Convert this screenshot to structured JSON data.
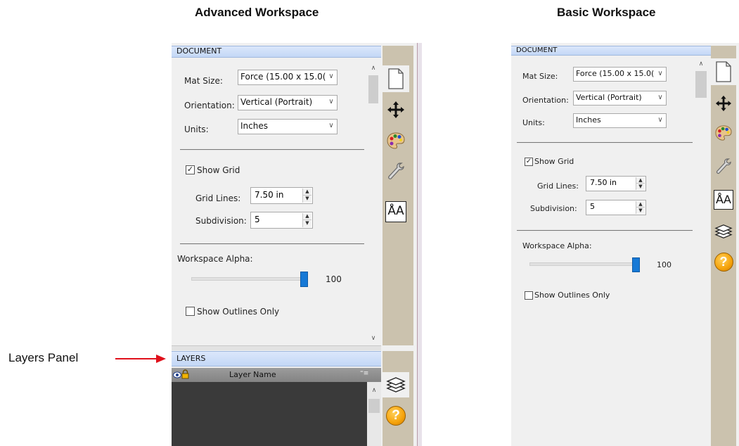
{
  "headings": {
    "advanced": "Advanced Workspace",
    "basic": "Basic Workspace"
  },
  "callout": {
    "label": "Layers Panel",
    "arrow_color": "#e0101b"
  },
  "document_panel": {
    "title": "DOCUMENT",
    "mat_size": {
      "label": "Mat Size:",
      "value": "Force (15.00 x 15.0("
    },
    "orientation": {
      "label": "Orientation:",
      "value": "Vertical (Portrait)"
    },
    "units": {
      "label": "Units:",
      "value": "Inches"
    },
    "show_grid": {
      "label": "Show Grid",
      "checked": true,
      "mark": "✓"
    },
    "grid_lines": {
      "label": "Grid Lines:",
      "value": "7.50 in"
    },
    "subdivision": {
      "label": "Subdivision:",
      "value": "5"
    },
    "workspace_alpha": {
      "label": "Workspace Alpha:",
      "value": "100",
      "level_percent": 100
    },
    "show_outlines_only": {
      "label": "Show Outlines Only",
      "checked": false
    }
  },
  "layers_panel": {
    "title": "LAYERS",
    "column_header": "Layer Name",
    "menu_glyph": "⁼≡"
  },
  "side_tabs": {
    "advanced": [
      "document-icon",
      "move-icon",
      "palette-icon",
      "wrench-icon",
      "text-icon"
    ],
    "advanced_lower": [
      "layers-icon",
      "help-icon"
    ],
    "basic": [
      "document-icon",
      "move-icon",
      "palette-icon",
      "wrench-icon",
      "text-icon",
      "layers-icon",
      "help-icon"
    ],
    "text_glyph": "ÅA",
    "help_glyph": "?"
  },
  "colors": {
    "panel_bg": "#f0f0f0",
    "section_header": "#c3d7f6",
    "tab_strip": "#cbc2ae",
    "slider_thumb": "#1679d6",
    "layers_body": "#3a3a3a",
    "help_icon": "#f5a20a"
  }
}
